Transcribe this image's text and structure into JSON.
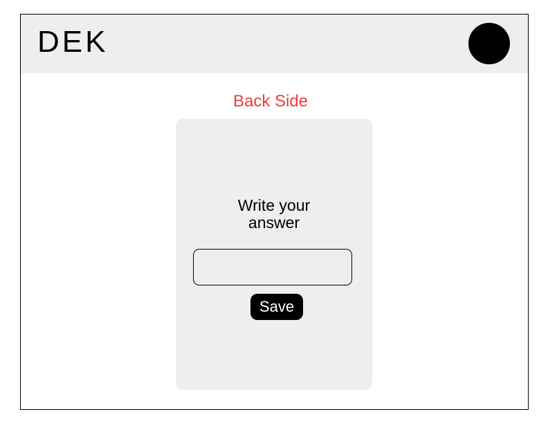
{
  "header": {
    "logo_text": "DEK",
    "avatar_icon": "user-avatar-circle"
  },
  "card_side": {
    "label": "Back Side",
    "label_color": "#ee3b3b"
  },
  "card": {
    "prompt": "Write your\nanswer",
    "answer_value": "",
    "answer_placeholder": "",
    "save_label": "Save"
  },
  "colors": {
    "header_bg": "#eeeeee",
    "card_bg": "#eeeeee",
    "button_bg": "#000000",
    "button_text": "#ffffff"
  }
}
